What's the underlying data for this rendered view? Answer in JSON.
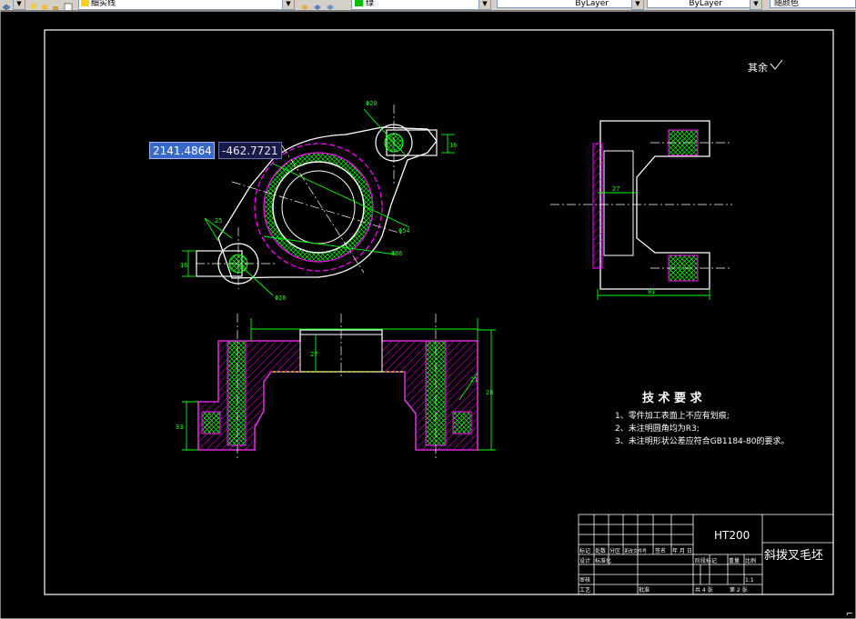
{
  "toolbar": {
    "linetype_label": "细实线",
    "layer_name": "绿",
    "color_value": "ByLayer",
    "linetype_value": "ByLayer",
    "lineweight_value": "随颜色"
  },
  "coords": {
    "x": "2141.4864",
    "y": "-462.7721"
  },
  "annotations": {
    "surface_rest": "其余",
    "tech_title": "技 术 要 求",
    "tech_1": "1、零件加工表面上不应有划痕;",
    "tech_2": "2、未注明圆角均为R3;",
    "tech_3": "3、未注明形状公差应符合GB1184-80的要求。"
  },
  "title_block": {
    "material": "HT200",
    "part_name": "斜拨叉毛坯",
    "row_mark": "标记",
    "row_count": "处数",
    "row_zone": "分区",
    "row_docno": "更改文件号",
    "row_sign": "签名",
    "row_date": "年 月 日",
    "designer": "设计",
    "standardize": "标准化",
    "stage_mark": "阶段标记",
    "weight": "重量",
    "scale": "比例",
    "review": "审核",
    "process": "工艺",
    "approve": "批准",
    "total_sheets": "共 4 张",
    "sheet_no": "第 2 张",
    "ratio": "1:1"
  },
  "dims": {
    "d_top_hole": "Φ20",
    "d_small_hole": "Φ20",
    "d_main_inner": "Φ54",
    "d_main_outer": "Φ86",
    "h_top_lug": "16",
    "h_left_lug": "16",
    "a_left": "25",
    "sec_inner": "27",
    "sec_total": "81",
    "front_center": "27",
    "front_right": "28",
    "front_left": "33",
    "front_side": "21"
  },
  "colors": {
    "background": "#000000",
    "outline": "#ffffff",
    "dimension": "#00ff00",
    "hatch": "#ff00ff",
    "center": "#ffffff",
    "highlight": "#ffff00"
  }
}
